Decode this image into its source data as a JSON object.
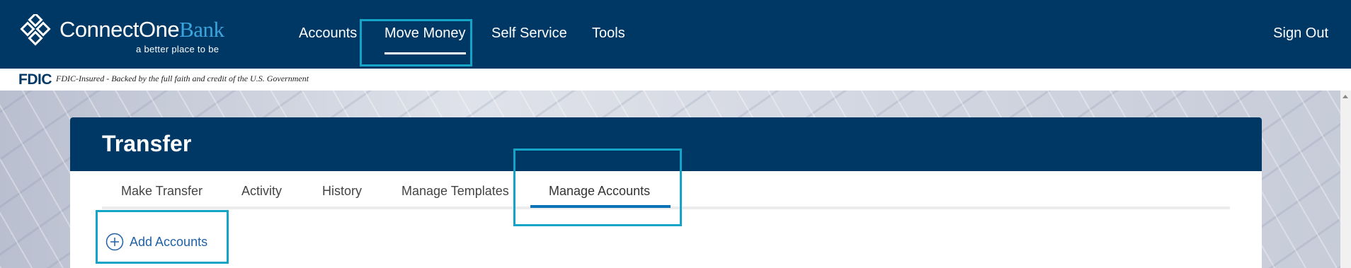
{
  "brand": {
    "name_part1": "ConnectOne",
    "name_part2": "Bank",
    "tagline": "a better place to be"
  },
  "nav": {
    "items": [
      "Accounts",
      "Move Money",
      "Self Service",
      "Tools"
    ],
    "active": "Move Money",
    "sign_out": "Sign Out"
  },
  "fdic": {
    "logo_text": "FDIC",
    "notice": "FDIC-Insured - Backed by the full faith and credit of the U.S. Government"
  },
  "page": {
    "title": "Transfer",
    "tabs": [
      "Make Transfer",
      "Activity",
      "History",
      "Manage Templates",
      "Manage Accounts"
    ],
    "active_tab": "Manage Accounts",
    "add_accounts_label": "Add Accounts"
  },
  "colors": {
    "navy": "#003865",
    "brand_blue": "#3aa6dd",
    "link_blue": "#1f61a8",
    "highlight": "#14a4c8"
  },
  "icons": [
    "connectone-logo-icon",
    "add-circle-icon",
    "scroll-up-arrow-icon"
  ]
}
